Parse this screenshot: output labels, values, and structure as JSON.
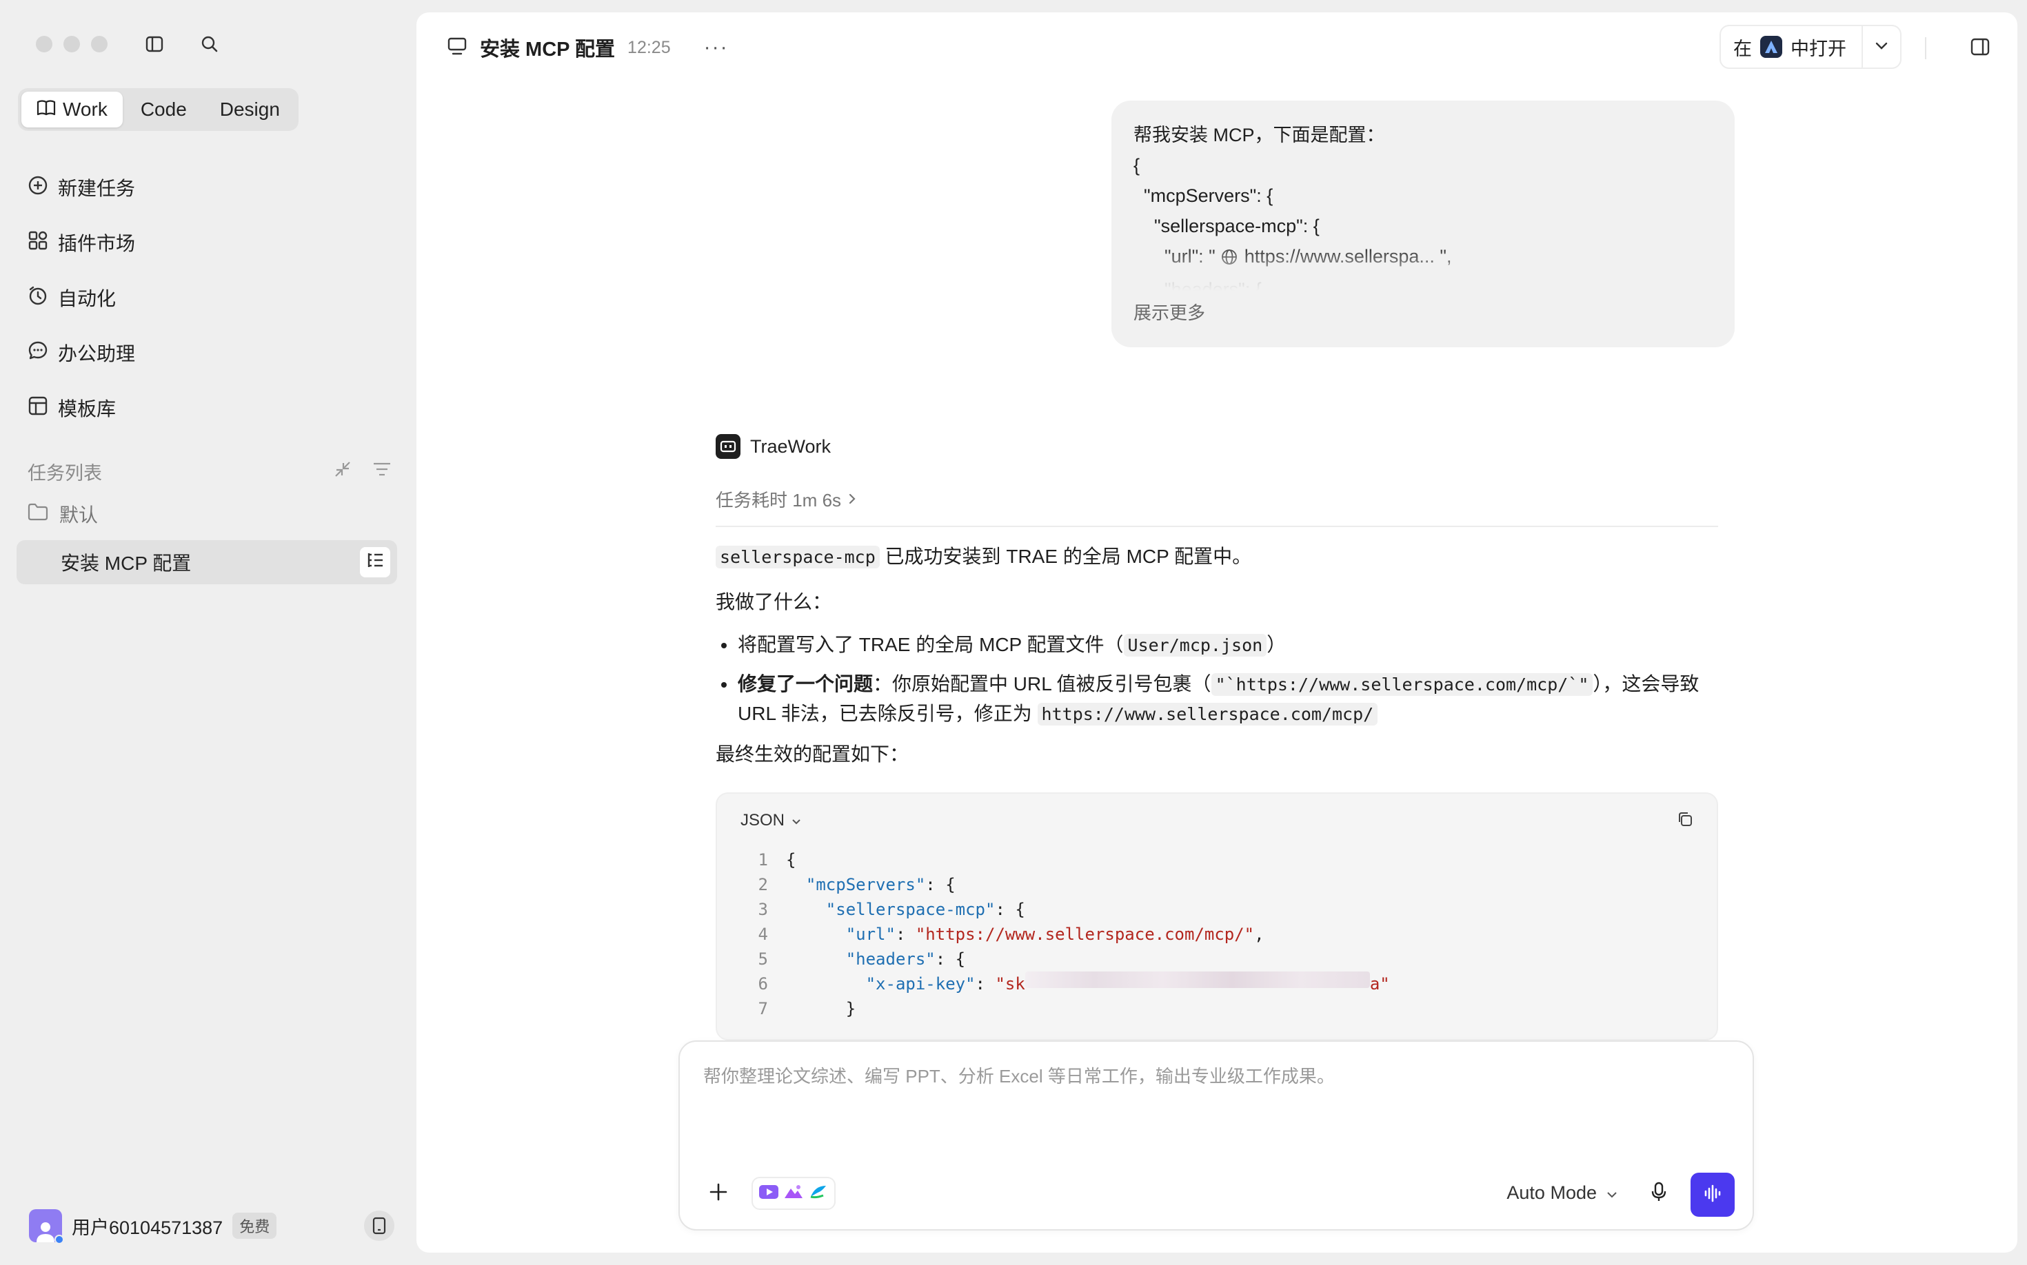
{
  "sidebar": {
    "modes": [
      {
        "label": "Work",
        "active": true
      },
      {
        "label": "Code",
        "active": false
      },
      {
        "label": "Design",
        "active": false
      }
    ],
    "nav": [
      {
        "label": "新建任务",
        "icon": "plus-circle-icon"
      },
      {
        "label": "插件市场",
        "icon": "plugin-grid-icon"
      },
      {
        "label": "自动化",
        "icon": "alarm-clock-icon"
      },
      {
        "label": "办公助理",
        "icon": "chat-bubble-icon"
      },
      {
        "label": "模板库",
        "icon": "template-icon"
      }
    ],
    "task_section": {
      "title": "任务列表"
    },
    "folder": {
      "label": "默认"
    },
    "active_task": {
      "label": "安装 MCP 配置"
    },
    "user": {
      "name": "用户60104571387",
      "plan": "免费"
    }
  },
  "header": {
    "title": "安装 MCP 配置",
    "time": "12:25",
    "more": "···",
    "open_in_prefix": "在",
    "open_in_suffix": "中打开"
  },
  "user_message": {
    "lines": [
      "帮我安装 MCP，下面是配置：",
      "{",
      "  \"mcpServers\": {",
      "    \"sellerspace-mcp\": {",
      "      \"url\": \"",
      "      \"headers\": {"
    ],
    "url_text": "https://www.sellerspa... \",",
    "show_more": "展示更多"
  },
  "assistant": {
    "name": "TraeWork",
    "duration": "任务耗时 1m 6s",
    "p1_code": "sellerspace-mcp",
    "p1_text": " 已成功安装到 TRAE 的全局 MCP 配置中。",
    "p2": "我做了什么：",
    "b1_text": "将配置写入了 TRAE 的全局 MCP 配置文件（",
    "b1_code": "User/mcp.json",
    "b1_end": "）",
    "b2_bold": "修复了一个问题",
    "b2_text": "：你原始配置中 URL 值被反引号包裹（",
    "b2_code1": "\"`https://www.sellerspace.com/mcp/`\"",
    "b2_text2": "），这会导致 URL 非法，已去除反引号，修正为 ",
    "b2_code2": "https://www.sellerspace.com/mcp/",
    "p3": "最终生效的配置如下："
  },
  "code_block": {
    "language": "JSON",
    "line_numbers": [
      "1",
      "2",
      "3",
      "4",
      "5",
      "6",
      "7"
    ],
    "l1": "{",
    "l2_key": "\"mcpServers\"",
    "l2_rest": ": {",
    "l3_key": "\"sellerspace-mcp\"",
    "l3_rest": ": {",
    "l4_key": "\"url\"",
    "l4_colon": ": ",
    "l4_val": "\"https://www.sellerspace.com/mcp/\"",
    "l4_end": ",",
    "l5_key": "\"headers\"",
    "l5_rest": ": {",
    "l6_key": "\"x-api-key\"",
    "l6_colon": ": ",
    "l6_val_start": "\"sk",
    "l6_val_end": "a\"",
    "l7": "}"
  },
  "composer": {
    "placeholder": "帮你整理论文综述、编写 PPT、分析 Excel 等日常工作，输出专业级工作成果。",
    "mode": "Auto Mode"
  },
  "colors": {
    "accent": "#4b39ef",
    "json_key": "#1f6fb2",
    "json_string": "#b3261e"
  }
}
